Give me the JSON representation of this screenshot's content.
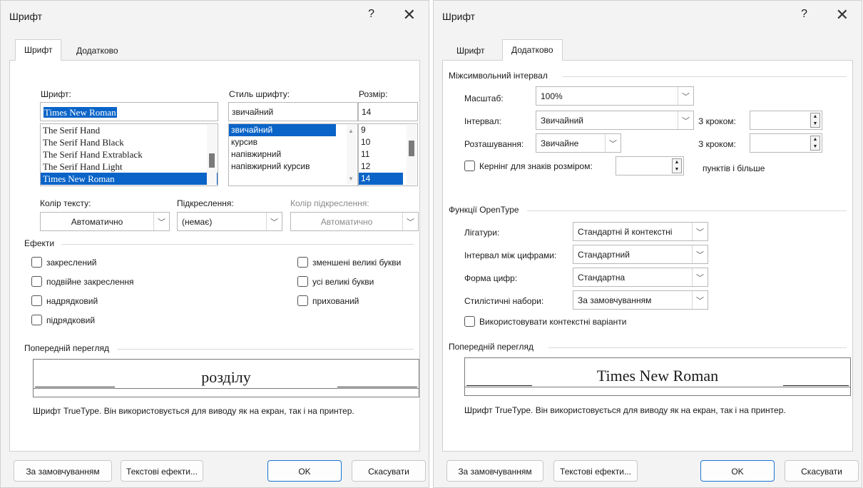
{
  "left": {
    "title": "Шрифт",
    "help": "?",
    "close": "✕",
    "tabs": [
      "Шрифт",
      "Додатково"
    ],
    "font_label": "Шрифт:",
    "font_value": "Times New Roman",
    "font_list": [
      "The Serif Hand",
      "The Serif Hand Black",
      "The Serif Hand Extrablack",
      "The Serif Hand Light",
      "Times New Roman"
    ],
    "style_label": "Стиль шрифту:",
    "style_value": "звичайний",
    "style_list": [
      "звичайний",
      "курсив",
      "напівжирний",
      "напівжирний курсив"
    ],
    "size_label": "Розмір:",
    "size_value": "14",
    "size_list": [
      "9",
      "10",
      "11",
      "12",
      "14"
    ],
    "color_label": "Колір тексту:",
    "color_value": "Автоматично",
    "underline_label": "Підкреслення:",
    "underline_value": "(немає)",
    "ucolor_label": "Колір підкреслення:",
    "ucolor_value": "Автоматично",
    "effects_title": "Ефекти",
    "effects": [
      "закреслений",
      "подвійне закреслення",
      "надрядковий",
      "підрядковий",
      "зменшені великі букви",
      "усі великі букви",
      "прихований"
    ],
    "preview_title": "Попередній перегляд",
    "preview_text": "розділу",
    "note": "Шрифт TrueType. Він використовується для виводу як на екран, так і на принтер.",
    "buttons": [
      "За замовчуванням",
      "Текстові ефекти...",
      "OK",
      "Скасувати"
    ]
  },
  "right": {
    "title": "Шрифт",
    "help": "?",
    "close": "✕",
    "tabs": [
      "Шрифт",
      "Додатково"
    ],
    "spacing_title": "Міжсимвольний інтервал",
    "scale_label": "Масштаб:",
    "scale_value": "100%",
    "interval_label": "Інтервал:",
    "interval_value": "Звичайний",
    "step1_label": "З кроком:",
    "position_label": "Розташування:",
    "position_value": "Звичайне",
    "step2_label": "З кроком:",
    "kerning_label": "Кернінг для знаків розміром:",
    "kerning_suffix": "пунктів і більше",
    "opentype_title": "Функції OpenType",
    "ligatures_label": "Лігатури:",
    "ligatures_value": "Стандартні й контекстні",
    "numspacing_label": "Інтервал між цифрами:",
    "numspacing_value": "Стандартний",
    "numform_label": "Форма цифр:",
    "numform_value": "Стандартна",
    "stylesets_label": "Стилістичні набори:",
    "stylesets_value": "За замовчуванням",
    "contextual_label": "Використовувати контекстні варіанти",
    "preview_title": "Попередній перегляд",
    "preview_text": "Times New Roman",
    "note": "Шрифт TrueType. Він використовується для виводу як на екран, так і на принтер.",
    "buttons": [
      "За замовчуванням",
      "Текстові ефекти...",
      "OK",
      "Скасувати"
    ]
  }
}
